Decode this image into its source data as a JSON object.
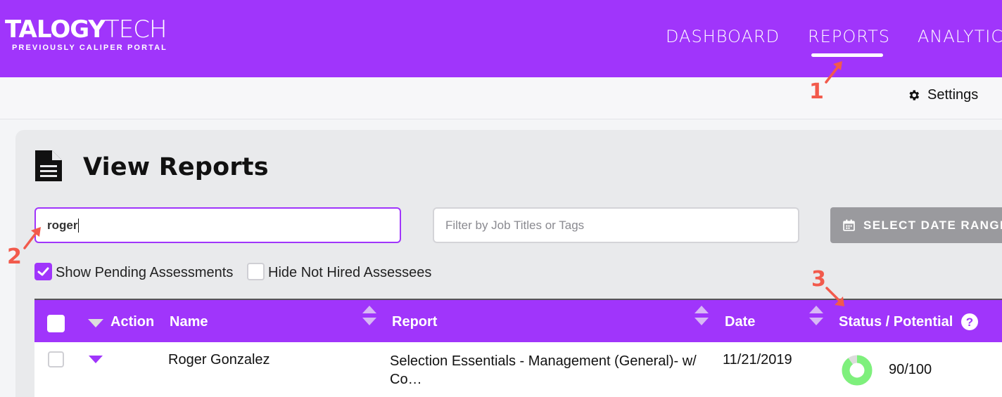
{
  "brand": {
    "logo_bold": "TALOGY",
    "logo_light": "TECH",
    "tagline": "PREVIOUSLY CALIPER PORTAL"
  },
  "nav": {
    "dashboard": "DASHBOARD",
    "reports": "REPORTS",
    "analytics": "ANALYTIC"
  },
  "subbar": {
    "settings": "Settings"
  },
  "page": {
    "title": "View Reports"
  },
  "search": {
    "value": "roger"
  },
  "filter": {
    "placeholder": "Filter by Job Titles or Tags"
  },
  "date_range": {
    "label": "SELECT DATE RANGE"
  },
  "options": {
    "show_pending": {
      "label": "Show Pending Assessments",
      "checked": true
    },
    "hide_not_hired": {
      "label": "Hide Not Hired Assessees",
      "checked": false
    }
  },
  "table": {
    "headers": {
      "action": "Action",
      "name": "Name",
      "report": "Report",
      "date": "Date",
      "status": "Status / Potential"
    },
    "rows": [
      {
        "name": "Roger Gonzalez",
        "report_line1": "Selection Essentials - Management (General)- w/",
        "report_line2": "Co…",
        "date": "11/21/2019",
        "score": "90/100",
        "score_value": 90
      }
    ]
  },
  "annotations": {
    "a1": "1",
    "a2": "2",
    "a3": "3"
  },
  "colors": {
    "accent": "#a035fb",
    "annotation": "#f25a4c",
    "donut": "#7ef07c"
  }
}
